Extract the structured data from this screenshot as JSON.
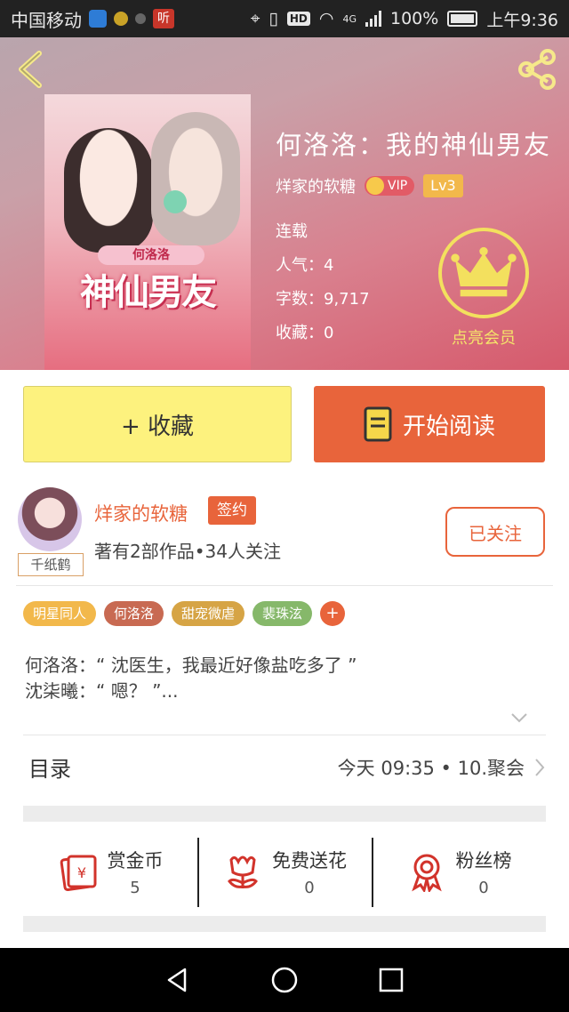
{
  "status_bar": {
    "carrier": "中国移动",
    "battery": "100%",
    "time": "上午9:36",
    "network": "4G",
    "hd": "HD",
    "ting": "听"
  },
  "cover": {
    "series_tag": "何洛洛",
    "title_art": "神仙男友"
  },
  "book": {
    "title": "何洛洛：我的神仙男友",
    "author": "烊家的软糖",
    "vip": "VIP",
    "level": "Lv3",
    "status": "连载",
    "popularity": "人气：4",
    "word_count": "字数：9,717",
    "collections": "收藏：0",
    "member_label": "点亮会员"
  },
  "actions": {
    "favorite": "+ 收藏",
    "read": "开始阅读"
  },
  "author": {
    "name": "烊家的软糖",
    "sign": "签约",
    "stats": "著有2部作品•34人关注",
    "follow": "已关注",
    "avatar_tag": "千纸鹤"
  },
  "tags": [
    {
      "label": "明星同人",
      "color": "#f2b84b"
    },
    {
      "label": "何洛洛",
      "color": "#c86a52"
    },
    {
      "label": "甜宠微虐",
      "color": "#d6a445"
    },
    {
      "label": "裴珠泫",
      "color": "#86b86a"
    }
  ],
  "tag_add": "+",
  "description": {
    "line1": "何洛洛：“ 沈医生，我最近好像盐吃多了 ”",
    "line2": "沈柒曦：“ 嗯？ ”..."
  },
  "toc": {
    "label": "目录",
    "latest": "今天 09:35 • 10.聚会"
  },
  "stats": [
    {
      "label": "赏金币",
      "value": "5",
      "icon": "red-envelope-icon"
    },
    {
      "label": "免费送花",
      "value": "0",
      "icon": "flower-icon"
    },
    {
      "label": "粉丝榜",
      "value": "0",
      "icon": "medal-icon"
    }
  ],
  "colors": {
    "accent": "#e8643b",
    "favorite_bg": "#fdf27e",
    "member_gold": "#f3e05e"
  }
}
